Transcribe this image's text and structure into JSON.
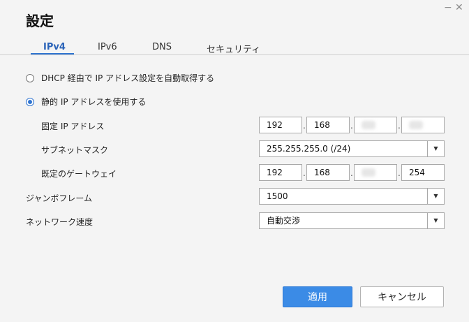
{
  "window": {
    "title": "設定",
    "minimize": "−",
    "close": "✕"
  },
  "tabs": [
    {
      "label": "IPv4",
      "active": true
    },
    {
      "label": "IPv6",
      "active": false
    },
    {
      "label": "DNS",
      "active": false
    },
    {
      "label": "セキュリティ",
      "active": false
    }
  ],
  "ip_mode": {
    "dhcp_label": "DHCP 経由で IP アドレス設定を自動取得する",
    "static_label": "静的 IP アドレスを使用する",
    "selected": "static"
  },
  "static": {
    "fixed_ip_label": "固定 IP アドレス",
    "fixed_ip": [
      "192",
      "168",
      "",
      ""
    ],
    "subnet_label": "サブネットマスク",
    "subnet_value": "255.255.255.0 (/24)",
    "gateway_label": "既定のゲートウェイ",
    "gateway": [
      "192",
      "168",
      "",
      "254"
    ]
  },
  "jumbo": {
    "label": "ジャンボフレーム",
    "value": "1500"
  },
  "speed": {
    "label": "ネットワーク速度",
    "value": "自動交渉"
  },
  "ip_separator": ".",
  "buttons": {
    "apply": "適用",
    "cancel": "キャンセル"
  },
  "colors": {
    "accent": "#2f74d0",
    "apply_bg": "#3b8be6",
    "background": "#f4f4f4"
  }
}
